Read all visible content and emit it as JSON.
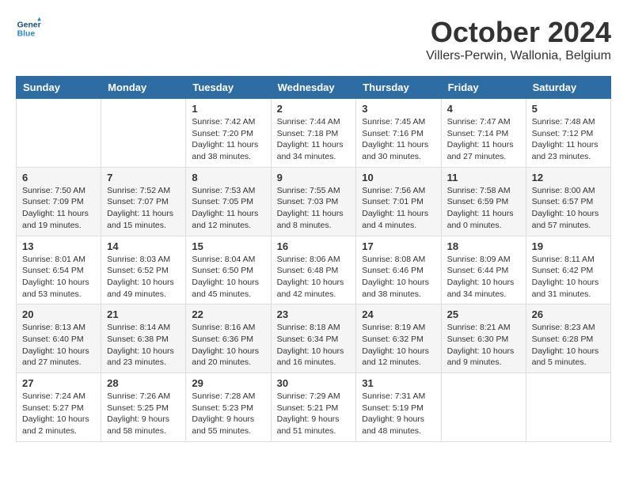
{
  "header": {
    "logo_line1": "General",
    "logo_line2": "Blue",
    "month_title": "October 2024",
    "location": "Villers-Perwin, Wallonia, Belgium"
  },
  "weekdays": [
    "Sunday",
    "Monday",
    "Tuesday",
    "Wednesday",
    "Thursday",
    "Friday",
    "Saturday"
  ],
  "weeks": [
    [
      {
        "day": "",
        "info": ""
      },
      {
        "day": "",
        "info": ""
      },
      {
        "day": "1",
        "info": "Sunrise: 7:42 AM\nSunset: 7:20 PM\nDaylight: 11 hours and 38 minutes."
      },
      {
        "day": "2",
        "info": "Sunrise: 7:44 AM\nSunset: 7:18 PM\nDaylight: 11 hours and 34 minutes."
      },
      {
        "day": "3",
        "info": "Sunrise: 7:45 AM\nSunset: 7:16 PM\nDaylight: 11 hours and 30 minutes."
      },
      {
        "day": "4",
        "info": "Sunrise: 7:47 AM\nSunset: 7:14 PM\nDaylight: 11 hours and 27 minutes."
      },
      {
        "day": "5",
        "info": "Sunrise: 7:48 AM\nSunset: 7:12 PM\nDaylight: 11 hours and 23 minutes."
      }
    ],
    [
      {
        "day": "6",
        "info": "Sunrise: 7:50 AM\nSunset: 7:09 PM\nDaylight: 11 hours and 19 minutes."
      },
      {
        "day": "7",
        "info": "Sunrise: 7:52 AM\nSunset: 7:07 PM\nDaylight: 11 hours and 15 minutes."
      },
      {
        "day": "8",
        "info": "Sunrise: 7:53 AM\nSunset: 7:05 PM\nDaylight: 11 hours and 12 minutes."
      },
      {
        "day": "9",
        "info": "Sunrise: 7:55 AM\nSunset: 7:03 PM\nDaylight: 11 hours and 8 minutes."
      },
      {
        "day": "10",
        "info": "Sunrise: 7:56 AM\nSunset: 7:01 PM\nDaylight: 11 hours and 4 minutes."
      },
      {
        "day": "11",
        "info": "Sunrise: 7:58 AM\nSunset: 6:59 PM\nDaylight: 11 hours and 0 minutes."
      },
      {
        "day": "12",
        "info": "Sunrise: 8:00 AM\nSunset: 6:57 PM\nDaylight: 10 hours and 57 minutes."
      }
    ],
    [
      {
        "day": "13",
        "info": "Sunrise: 8:01 AM\nSunset: 6:54 PM\nDaylight: 10 hours and 53 minutes."
      },
      {
        "day": "14",
        "info": "Sunrise: 8:03 AM\nSunset: 6:52 PM\nDaylight: 10 hours and 49 minutes."
      },
      {
        "day": "15",
        "info": "Sunrise: 8:04 AM\nSunset: 6:50 PM\nDaylight: 10 hours and 45 minutes."
      },
      {
        "day": "16",
        "info": "Sunrise: 8:06 AM\nSunset: 6:48 PM\nDaylight: 10 hours and 42 minutes."
      },
      {
        "day": "17",
        "info": "Sunrise: 8:08 AM\nSunset: 6:46 PM\nDaylight: 10 hours and 38 minutes."
      },
      {
        "day": "18",
        "info": "Sunrise: 8:09 AM\nSunset: 6:44 PM\nDaylight: 10 hours and 34 minutes."
      },
      {
        "day": "19",
        "info": "Sunrise: 8:11 AM\nSunset: 6:42 PM\nDaylight: 10 hours and 31 minutes."
      }
    ],
    [
      {
        "day": "20",
        "info": "Sunrise: 8:13 AM\nSunset: 6:40 PM\nDaylight: 10 hours and 27 minutes."
      },
      {
        "day": "21",
        "info": "Sunrise: 8:14 AM\nSunset: 6:38 PM\nDaylight: 10 hours and 23 minutes."
      },
      {
        "day": "22",
        "info": "Sunrise: 8:16 AM\nSunset: 6:36 PM\nDaylight: 10 hours and 20 minutes."
      },
      {
        "day": "23",
        "info": "Sunrise: 8:18 AM\nSunset: 6:34 PM\nDaylight: 10 hours and 16 minutes."
      },
      {
        "day": "24",
        "info": "Sunrise: 8:19 AM\nSunset: 6:32 PM\nDaylight: 10 hours and 12 minutes."
      },
      {
        "day": "25",
        "info": "Sunrise: 8:21 AM\nSunset: 6:30 PM\nDaylight: 10 hours and 9 minutes."
      },
      {
        "day": "26",
        "info": "Sunrise: 8:23 AM\nSunset: 6:28 PM\nDaylight: 10 hours and 5 minutes."
      }
    ],
    [
      {
        "day": "27",
        "info": "Sunrise: 7:24 AM\nSunset: 5:27 PM\nDaylight: 10 hours and 2 minutes."
      },
      {
        "day": "28",
        "info": "Sunrise: 7:26 AM\nSunset: 5:25 PM\nDaylight: 9 hours and 58 minutes."
      },
      {
        "day": "29",
        "info": "Sunrise: 7:28 AM\nSunset: 5:23 PM\nDaylight: 9 hours and 55 minutes."
      },
      {
        "day": "30",
        "info": "Sunrise: 7:29 AM\nSunset: 5:21 PM\nDaylight: 9 hours and 51 minutes."
      },
      {
        "day": "31",
        "info": "Sunrise: 7:31 AM\nSunset: 5:19 PM\nDaylight: 9 hours and 48 minutes."
      },
      {
        "day": "",
        "info": ""
      },
      {
        "day": "",
        "info": ""
      }
    ]
  ]
}
